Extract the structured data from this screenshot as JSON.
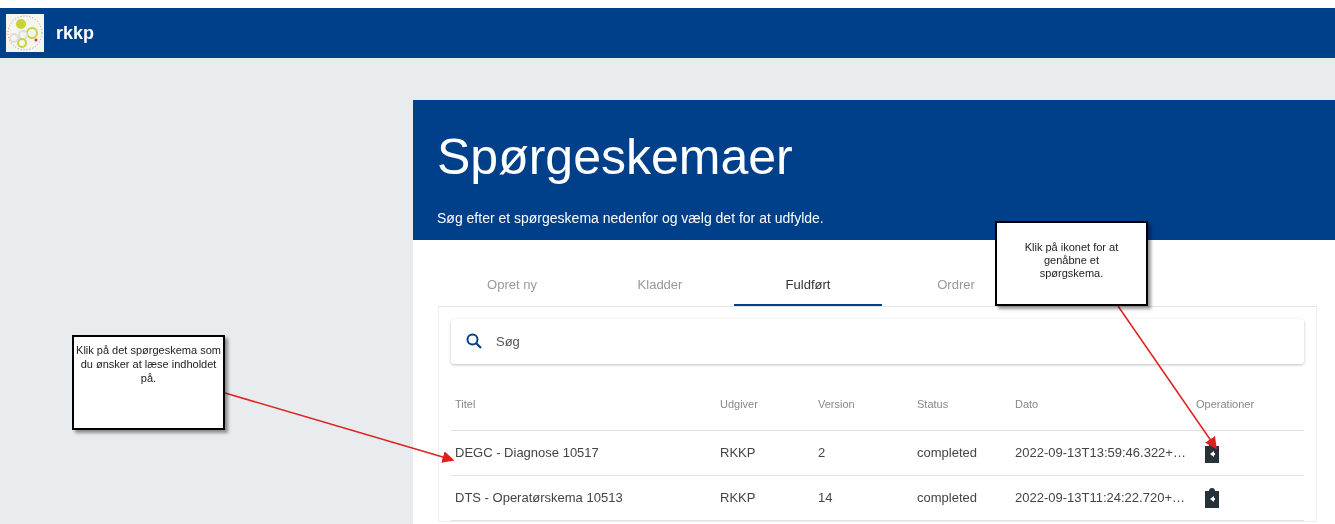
{
  "app_bar": {
    "title": "rkkp"
  },
  "page": {
    "title": "Spørgeskemaer",
    "subtitle": "Søg efter et spørgeskema nedenfor og vælg det for at udfylde."
  },
  "tabs": [
    {
      "label": "Opret ny",
      "selected": false
    },
    {
      "label": "Kladder",
      "selected": false
    },
    {
      "label": "Fuldført",
      "selected": true
    },
    {
      "label": "Ordrer",
      "selected": false
    }
  ],
  "search": {
    "placeholder": "Søg"
  },
  "table": {
    "columns": [
      "Titel",
      "Udgiver",
      "Version",
      "Status",
      "Dato",
      "Operationer"
    ],
    "rows": [
      {
        "title": "DEGC - Diagnose 10517",
        "publisher": "RKKP",
        "version": "2",
        "status": "completed",
        "date": "2022-09-13T13:59:46.322+…"
      },
      {
        "title": "DTS - Operatørskema 10513",
        "publisher": "RKKP",
        "version": "14",
        "status": "completed",
        "date": "2022-09-13T11:24:22.720+…"
      }
    ]
  },
  "callouts": [
    {
      "text": "Klik på det spørgeskema som du ønsker at læse indholdet på."
    },
    {
      "text": "Klik på ikonet for at genåbne et spørgskema."
    }
  ]
}
